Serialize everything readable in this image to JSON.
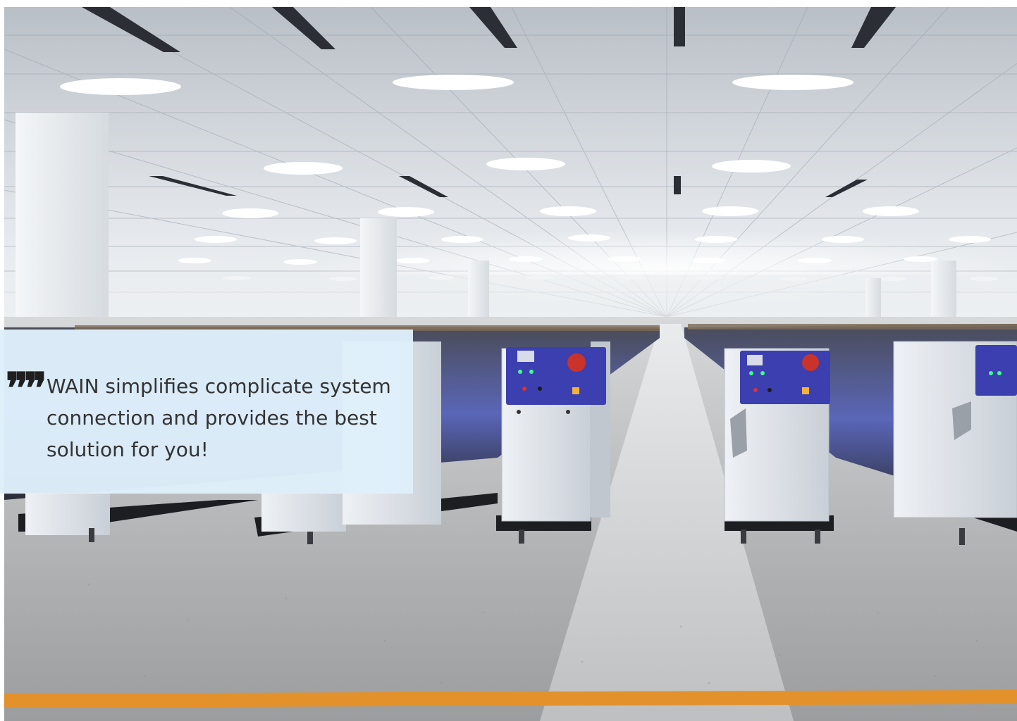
{
  "hero": {
    "photo_subject": "textile-spinning-factory",
    "colors": {
      "panel_bg": "#dff0fb",
      "floor_stripe": "#e3912b",
      "machine_panel": "#3b3fb0",
      "text": "#333333"
    }
  },
  "quote": {
    "mark": "❞",
    "text": "WAIN simplifies complicate system connection and provides the best solution for you!"
  }
}
